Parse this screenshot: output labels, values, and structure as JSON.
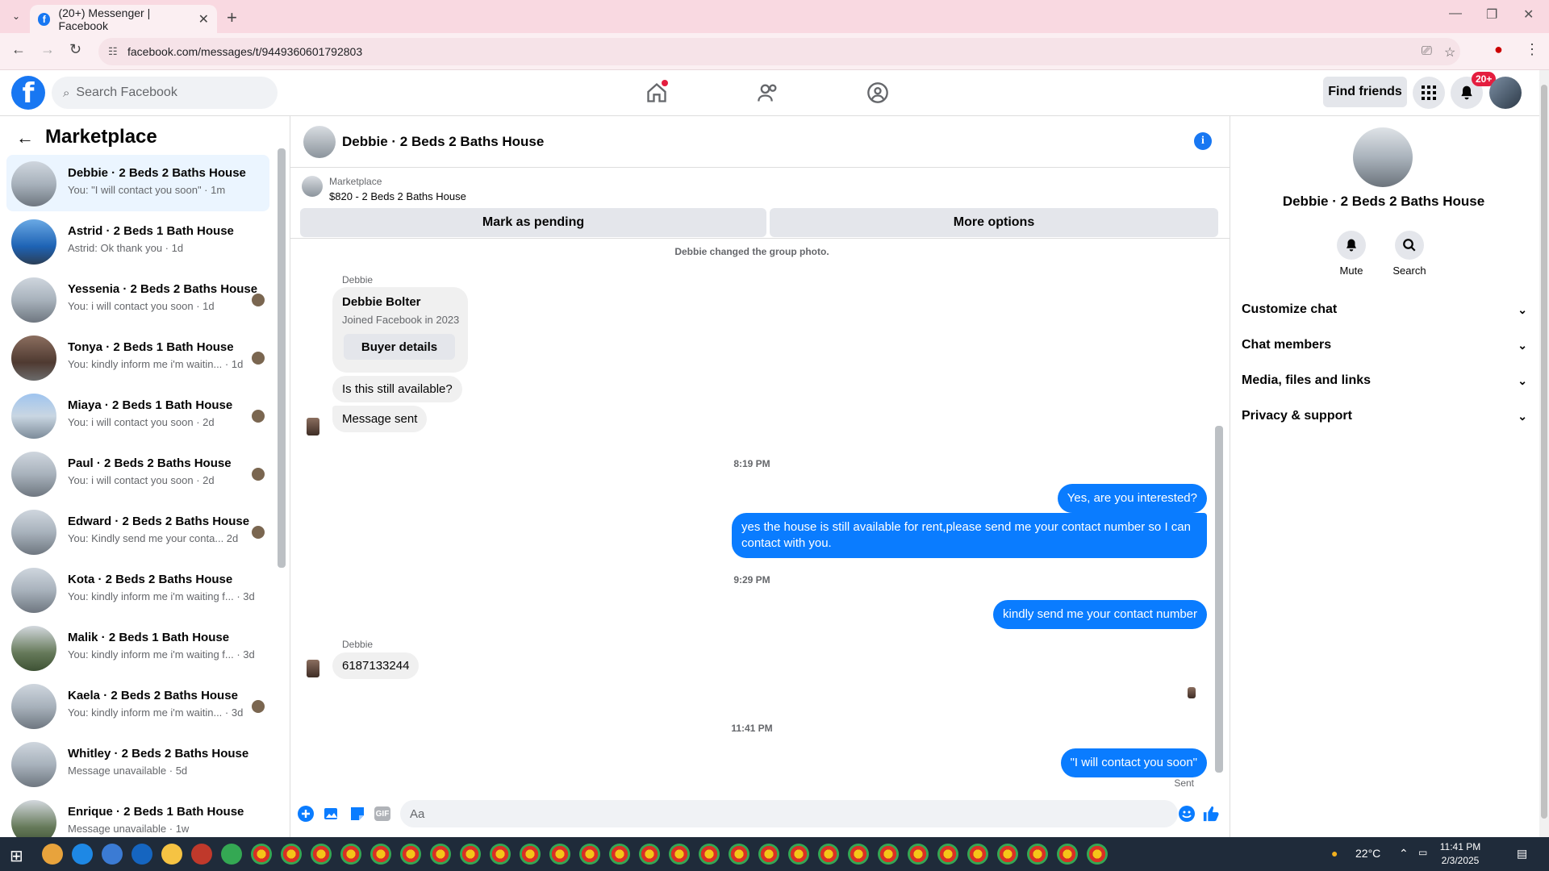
{
  "browser": {
    "tab_title": "(20+) Messenger | Facebook",
    "url": "facebook.com/messages/t/9449360601792803"
  },
  "header": {
    "search_placeholder": "Search Facebook",
    "find_friends": "Find friends",
    "notif_badge": "20+"
  },
  "sidebar": {
    "title": "Marketplace",
    "conversations": [
      {
        "name": "Debbie · 2 Beds 2 Baths House",
        "preview": "You: \"I will contact you soon\" · 1m",
        "active": true
      },
      {
        "name": "Astrid · 2 Beds 1 Bath House",
        "preview": "Astrid: Ok thank you · 1d"
      },
      {
        "name": "Yessenia · 2 Beds 2 Baths House",
        "preview": "You: i will contact you soon · 1d"
      },
      {
        "name": "Tonya · 2 Beds 1 Bath House",
        "preview": "You: kindly inform me i'm waitin... · 1d"
      },
      {
        "name": "Miaya · 2 Beds 1 Bath House",
        "preview": "You: i will contact you soon · 2d"
      },
      {
        "name": "Paul · 2 Beds 2 Baths House",
        "preview": "You: i will contact you soon · 2d"
      },
      {
        "name": "Edward · 2 Beds 2 Baths House",
        "preview": "You: Kindly send me your conta...  2d"
      },
      {
        "name": "Kota · 2 Beds 2 Baths House",
        "preview": "You: kindly inform me i'm waiting f... · 3d"
      },
      {
        "name": "Malik · 2 Beds 1 Bath House",
        "preview": "You: kindly inform me i'm waiting f... · 3d"
      },
      {
        "name": "Kaela · 2 Beds 2 Baths House",
        "preview": "You: kindly inform me i'm waitin... · 3d"
      },
      {
        "name": "Whitley · 2 Beds 2 Baths House",
        "preview": "Message unavailable · 5d"
      },
      {
        "name": "Enrique · 2 Beds 1 Bath House",
        "preview": "Message unavailable · 1w"
      }
    ]
  },
  "chat": {
    "title": "Debbie · 2 Beds 2 Baths House",
    "marketplace_label": "Marketplace",
    "listing": "$820 - 2 Beds 2 Baths House",
    "mark_pending": "Mark as pending",
    "more_options": "More options",
    "system_note": "Debbie changed the group photo.",
    "sender": "Debbie",
    "profile_name": "Debbie Bolter",
    "profile_sub": "Joined Facebook in 2023",
    "buyer_details": "Buyer details",
    "msg1": "Is this still available?",
    "msg2": "Message sent",
    "time1": "8:19 PM",
    "out1": "Yes, are you interested?",
    "out2": "yes the house is still available for rent,please send me your contact number so I can contact with you.",
    "time2": "9:29 PM",
    "out3": "kindly send me your contact number",
    "sender2": "Debbie",
    "msg3": "6187133244",
    "time3": "11:41 PM",
    "out4": "\"I will contact you soon\"",
    "sent_status": "Sent",
    "composer_placeholder": "Aa"
  },
  "right_panel": {
    "name": "Debbie · 2 Beds 2 Baths House",
    "mute": "Mute",
    "search": "Search",
    "sections": [
      "Customize chat",
      "Chat members",
      "Media, files and links",
      "Privacy & support"
    ]
  },
  "taskbar": {
    "temperature": "22°C",
    "time": "11:41 PM",
    "date": "2/3/2025"
  },
  "colors": {
    "accent": "#1877f2",
    "bubble_out": "#0a7cff",
    "tab_bar": "#f9d9e1"
  }
}
